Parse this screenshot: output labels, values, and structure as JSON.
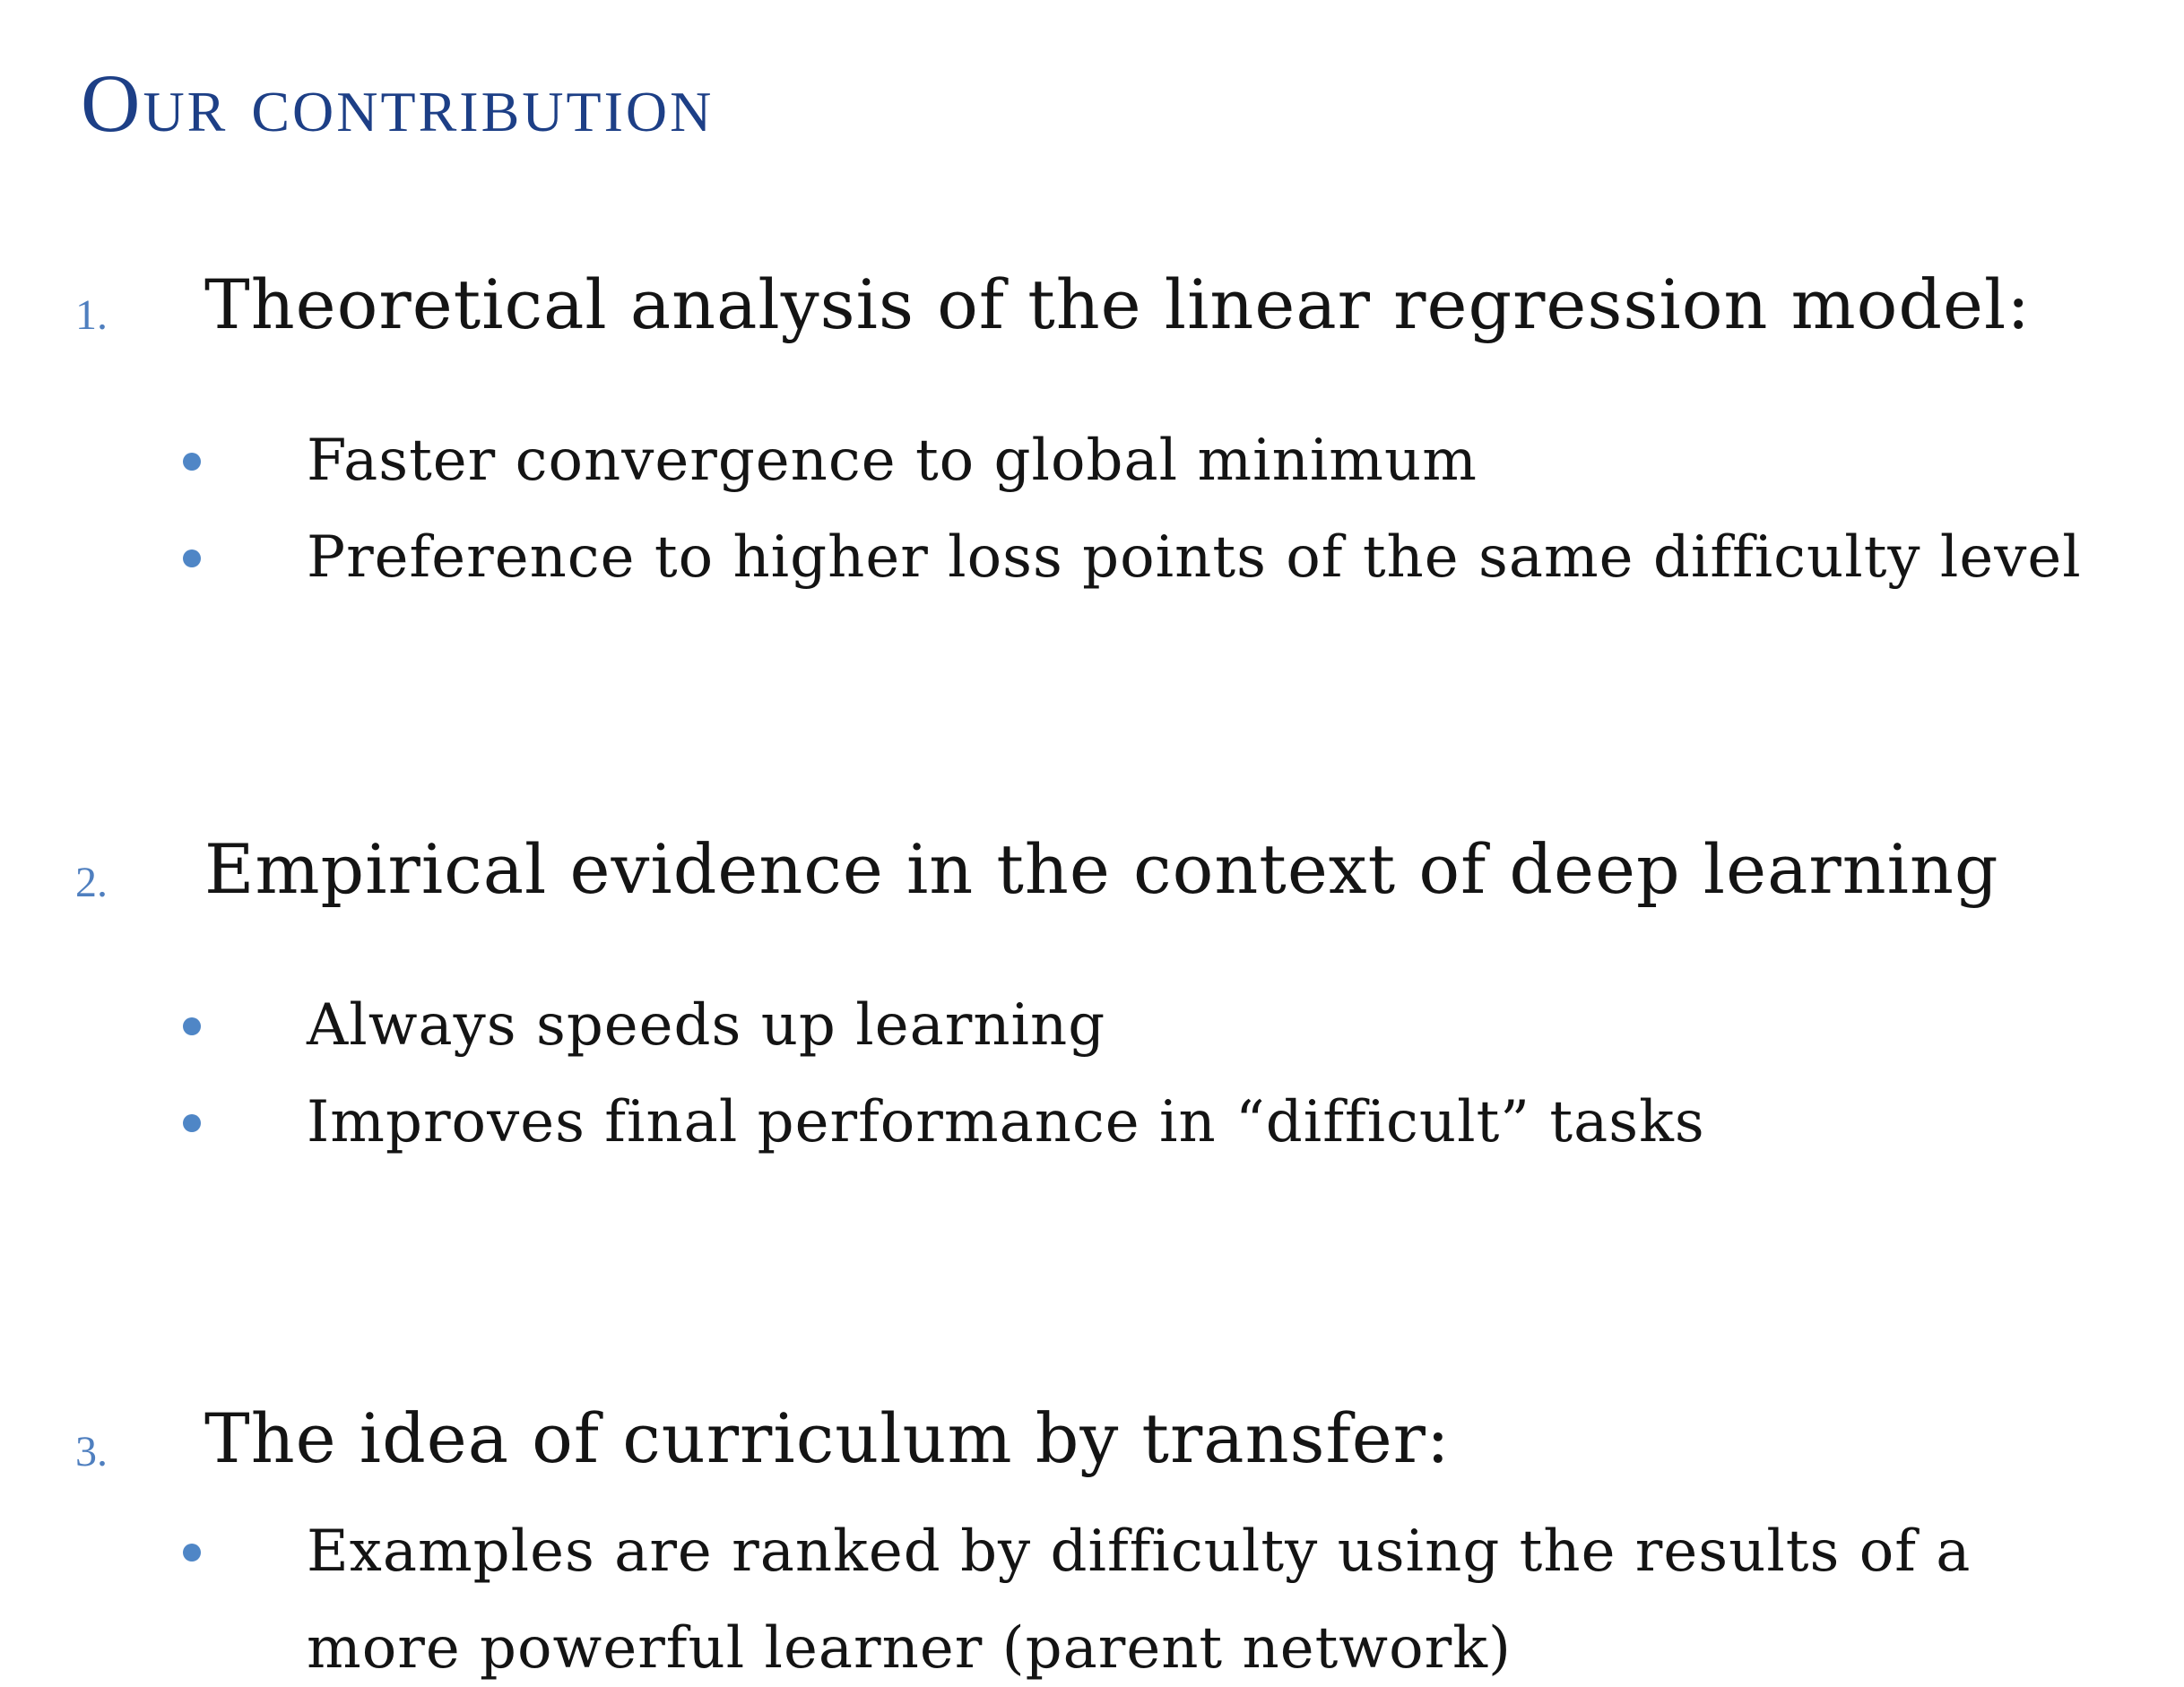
{
  "slide": {
    "title": "Our contribution",
    "items": [
      {
        "number": "1.",
        "heading": "Theoretical analysis of the linear regression model:",
        "bullets": [
          "Faster convergence to global minimum",
          "Preference to higher loss points of the same difficulty level"
        ]
      },
      {
        "number": "2.",
        "heading": "Empirical evidence in the context of deep learning",
        "bullets": [
          "Always speeds up learning",
          "Improves final performance in “difficult” tasks"
        ]
      },
      {
        "number": "3.",
        "heading": "The idea of curriculum by transfer:",
        "bullets": [
          "Examples are ranked by difficulty using the results of a more powerful learner (parent network)"
        ]
      }
    ],
    "colors": {
      "title": "#1d3f86",
      "number": "#4f7fbf",
      "bullet": "#4f86c6",
      "text": "#141414",
      "background": "#ffffff"
    }
  }
}
